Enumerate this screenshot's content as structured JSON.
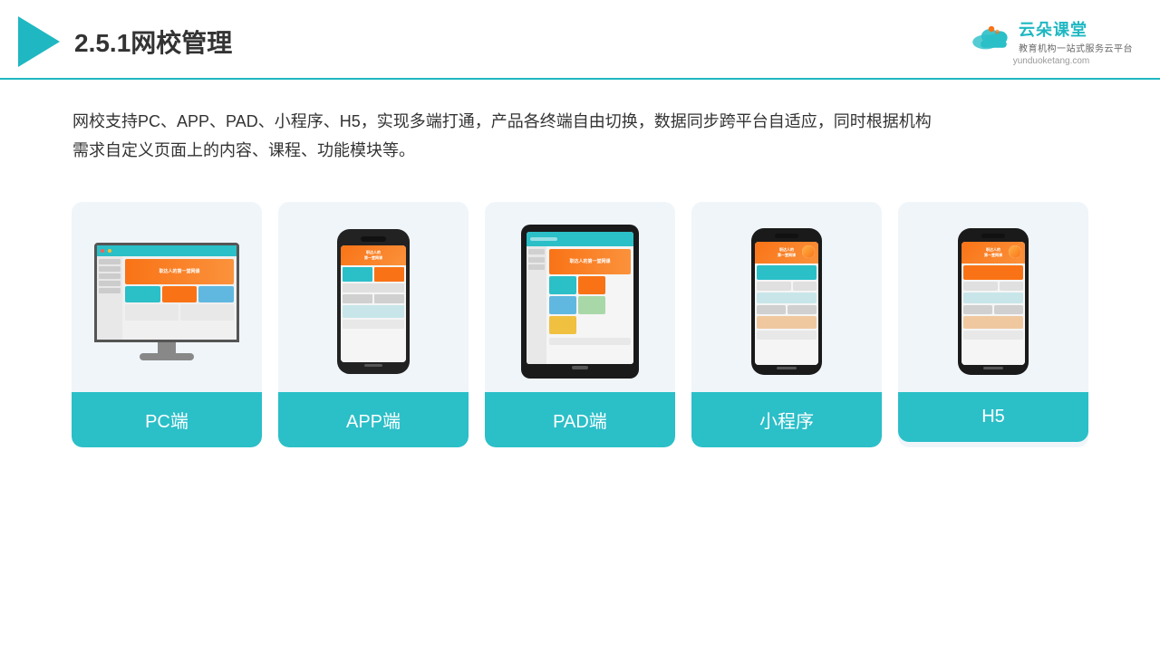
{
  "header": {
    "title": "2.5.1网校管理",
    "brand_name": "云朵课堂",
    "brand_tagline": "教育机构一站\n式服务云平台",
    "brand_url": "yunduoketang.com"
  },
  "description": {
    "text": "网校支持PC、APP、PAD、小程序、H5，实现多端打通，产品各终端自由切换，数据同步跨平台自适应，同时根据机构需求自定义页面上的内容、课程、功能模块等。"
  },
  "cards": [
    {
      "id": "pc",
      "label": "PC端"
    },
    {
      "id": "app",
      "label": "APP端"
    },
    {
      "id": "pad",
      "label": "PAD端"
    },
    {
      "id": "miniprogram",
      "label": "小程序"
    },
    {
      "id": "h5",
      "label": "H5"
    }
  ],
  "colors": {
    "teal": "#2bbfc8",
    "orange": "#f97316",
    "bg_card": "#f0f5fa"
  }
}
